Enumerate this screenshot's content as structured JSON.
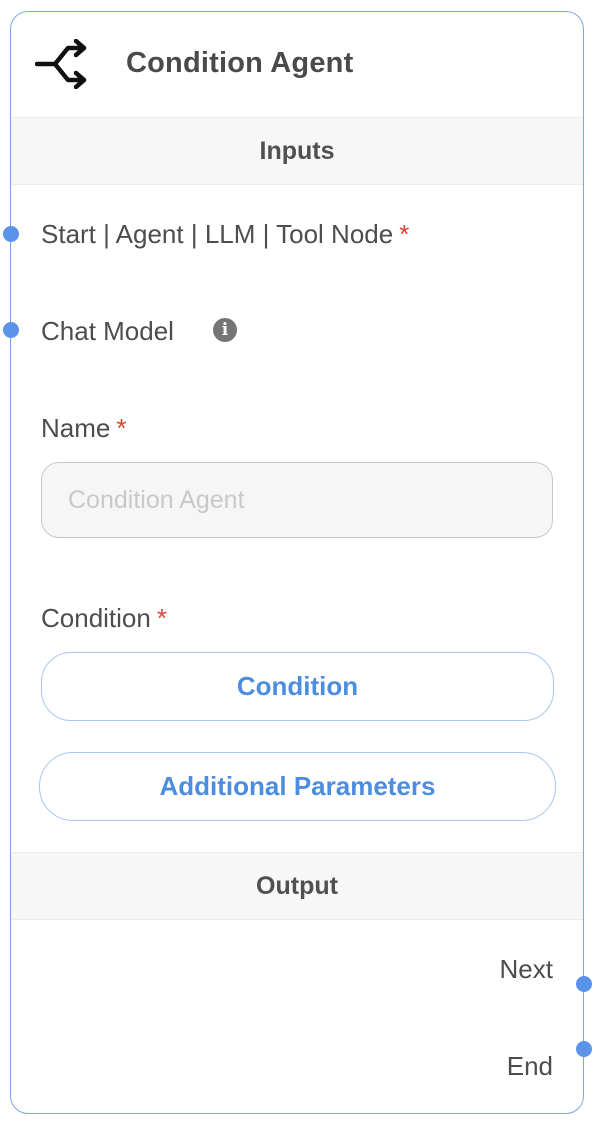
{
  "node": {
    "title": "Condition Agent",
    "icon": "split-arrows-icon"
  },
  "inputs": {
    "heading": "Inputs",
    "anchor_label": "Start | Agent | LLM | Tool Node",
    "anchor_required": "*",
    "chat_model_label": "Chat Model",
    "chat_model_info": "i",
    "name_label": "Name",
    "name_required": "*",
    "name_placeholder": "Condition Agent",
    "name_value": "",
    "condition_label": "Condition",
    "condition_required": "*",
    "condition_button": "Condition",
    "additional_params_button": "Additional Parameters"
  },
  "output": {
    "heading": "Output",
    "next_label": "Next",
    "end_label": "End"
  },
  "colors": {
    "accent": "#4d8de0",
    "border": "#7aa7e8",
    "handle": "#5b93ea",
    "required": "#d9442f"
  }
}
